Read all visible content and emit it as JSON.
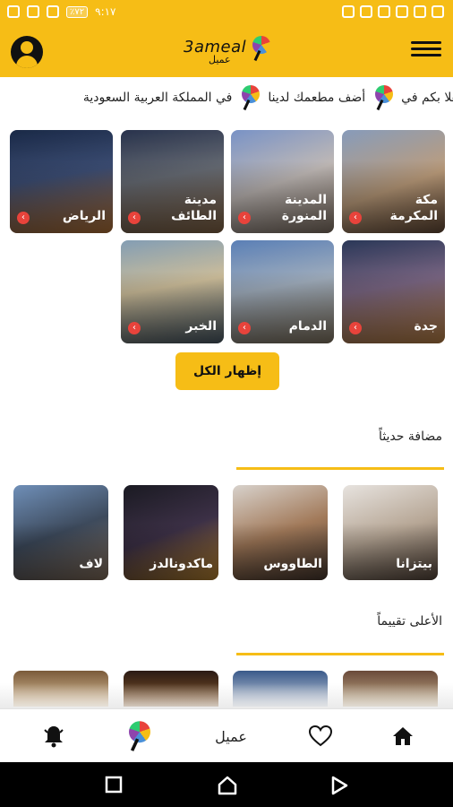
{
  "status": {
    "time": "٩:١٧",
    "battery": "٪٧٢"
  },
  "header": {
    "logo_text": "3ameal",
    "logo_sub": "عميل"
  },
  "ticker": {
    "items": [
      "اهلا بكم في",
      "أضف مطعمك لدينا",
      "في المملكة العربية السعودية"
    ]
  },
  "cities": [
    {
      "name": "مكة\nالمكرمة"
    },
    {
      "name": "المدينة\nالمنورة"
    },
    {
      "name": "مدينة\nالطائف"
    },
    {
      "name": "الرياض"
    },
    {
      "name": "جدة"
    },
    {
      "name": "الدمام"
    },
    {
      "name": "الخبر"
    }
  ],
  "show_all_label": "إظهار الكل",
  "recent": {
    "title": "مضافة حديثاً",
    "items": [
      {
        "name": "بيتزانا"
      },
      {
        "name": "الطاووس"
      },
      {
        "name": "ماكدونالدز"
      },
      {
        "name": "لاف"
      }
    ]
  },
  "top_rated": {
    "title": "الأعلى تقييماً"
  },
  "bottom_nav": {
    "brand_label": "عميل"
  },
  "colors": {
    "accent": "#f6bd16",
    "dark": "#111111"
  }
}
